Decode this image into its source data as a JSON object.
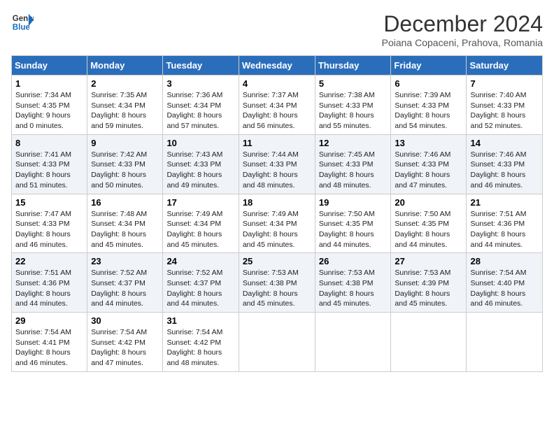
{
  "header": {
    "logo_line1": "General",
    "logo_line2": "Blue",
    "month_title": "December 2024",
    "subtitle": "Poiana Copaceni, Prahova, Romania"
  },
  "weekdays": [
    "Sunday",
    "Monday",
    "Tuesday",
    "Wednesday",
    "Thursday",
    "Friday",
    "Saturday"
  ],
  "weeks": [
    [
      {
        "day": "1",
        "sunrise": "7:34 AM",
        "sunset": "4:35 PM",
        "daylight": "9 hours and 0 minutes."
      },
      {
        "day": "2",
        "sunrise": "7:35 AM",
        "sunset": "4:34 PM",
        "daylight": "8 hours and 59 minutes."
      },
      {
        "day": "3",
        "sunrise": "7:36 AM",
        "sunset": "4:34 PM",
        "daylight": "8 hours and 57 minutes."
      },
      {
        "day": "4",
        "sunrise": "7:37 AM",
        "sunset": "4:34 PM",
        "daylight": "8 hours and 56 minutes."
      },
      {
        "day": "5",
        "sunrise": "7:38 AM",
        "sunset": "4:33 PM",
        "daylight": "8 hours and 55 minutes."
      },
      {
        "day": "6",
        "sunrise": "7:39 AM",
        "sunset": "4:33 PM",
        "daylight": "8 hours and 54 minutes."
      },
      {
        "day": "7",
        "sunrise": "7:40 AM",
        "sunset": "4:33 PM",
        "daylight": "8 hours and 52 minutes."
      }
    ],
    [
      {
        "day": "8",
        "sunrise": "7:41 AM",
        "sunset": "4:33 PM",
        "daylight": "8 hours and 51 minutes."
      },
      {
        "day": "9",
        "sunrise": "7:42 AM",
        "sunset": "4:33 PM",
        "daylight": "8 hours and 50 minutes."
      },
      {
        "day": "10",
        "sunrise": "7:43 AM",
        "sunset": "4:33 PM",
        "daylight": "8 hours and 49 minutes."
      },
      {
        "day": "11",
        "sunrise": "7:44 AM",
        "sunset": "4:33 PM",
        "daylight": "8 hours and 48 minutes."
      },
      {
        "day": "12",
        "sunrise": "7:45 AM",
        "sunset": "4:33 PM",
        "daylight": "8 hours and 48 minutes."
      },
      {
        "day": "13",
        "sunrise": "7:46 AM",
        "sunset": "4:33 PM",
        "daylight": "8 hours and 47 minutes."
      },
      {
        "day": "14",
        "sunrise": "7:46 AM",
        "sunset": "4:33 PM",
        "daylight": "8 hours and 46 minutes."
      }
    ],
    [
      {
        "day": "15",
        "sunrise": "7:47 AM",
        "sunset": "4:33 PM",
        "daylight": "8 hours and 46 minutes."
      },
      {
        "day": "16",
        "sunrise": "7:48 AM",
        "sunset": "4:34 PM",
        "daylight": "8 hours and 45 minutes."
      },
      {
        "day": "17",
        "sunrise": "7:49 AM",
        "sunset": "4:34 PM",
        "daylight": "8 hours and 45 minutes."
      },
      {
        "day": "18",
        "sunrise": "7:49 AM",
        "sunset": "4:34 PM",
        "daylight": "8 hours and 45 minutes."
      },
      {
        "day": "19",
        "sunrise": "7:50 AM",
        "sunset": "4:35 PM",
        "daylight": "8 hours and 44 minutes."
      },
      {
        "day": "20",
        "sunrise": "7:50 AM",
        "sunset": "4:35 PM",
        "daylight": "8 hours and 44 minutes."
      },
      {
        "day": "21",
        "sunrise": "7:51 AM",
        "sunset": "4:36 PM",
        "daylight": "8 hours and 44 minutes."
      }
    ],
    [
      {
        "day": "22",
        "sunrise": "7:51 AM",
        "sunset": "4:36 PM",
        "daylight": "8 hours and 44 minutes."
      },
      {
        "day": "23",
        "sunrise": "7:52 AM",
        "sunset": "4:37 PM",
        "daylight": "8 hours and 44 minutes."
      },
      {
        "day": "24",
        "sunrise": "7:52 AM",
        "sunset": "4:37 PM",
        "daylight": "8 hours and 44 minutes."
      },
      {
        "day": "25",
        "sunrise": "7:53 AM",
        "sunset": "4:38 PM",
        "daylight": "8 hours and 45 minutes."
      },
      {
        "day": "26",
        "sunrise": "7:53 AM",
        "sunset": "4:38 PM",
        "daylight": "8 hours and 45 minutes."
      },
      {
        "day": "27",
        "sunrise": "7:53 AM",
        "sunset": "4:39 PM",
        "daylight": "8 hours and 45 minutes."
      },
      {
        "day": "28",
        "sunrise": "7:54 AM",
        "sunset": "4:40 PM",
        "daylight": "8 hours and 46 minutes."
      }
    ],
    [
      {
        "day": "29",
        "sunrise": "7:54 AM",
        "sunset": "4:41 PM",
        "daylight": "8 hours and 46 minutes."
      },
      {
        "day": "30",
        "sunrise": "7:54 AM",
        "sunset": "4:42 PM",
        "daylight": "8 hours and 47 minutes."
      },
      {
        "day": "31",
        "sunrise": "7:54 AM",
        "sunset": "4:42 PM",
        "daylight": "8 hours and 48 minutes."
      },
      null,
      null,
      null,
      null
    ]
  ]
}
